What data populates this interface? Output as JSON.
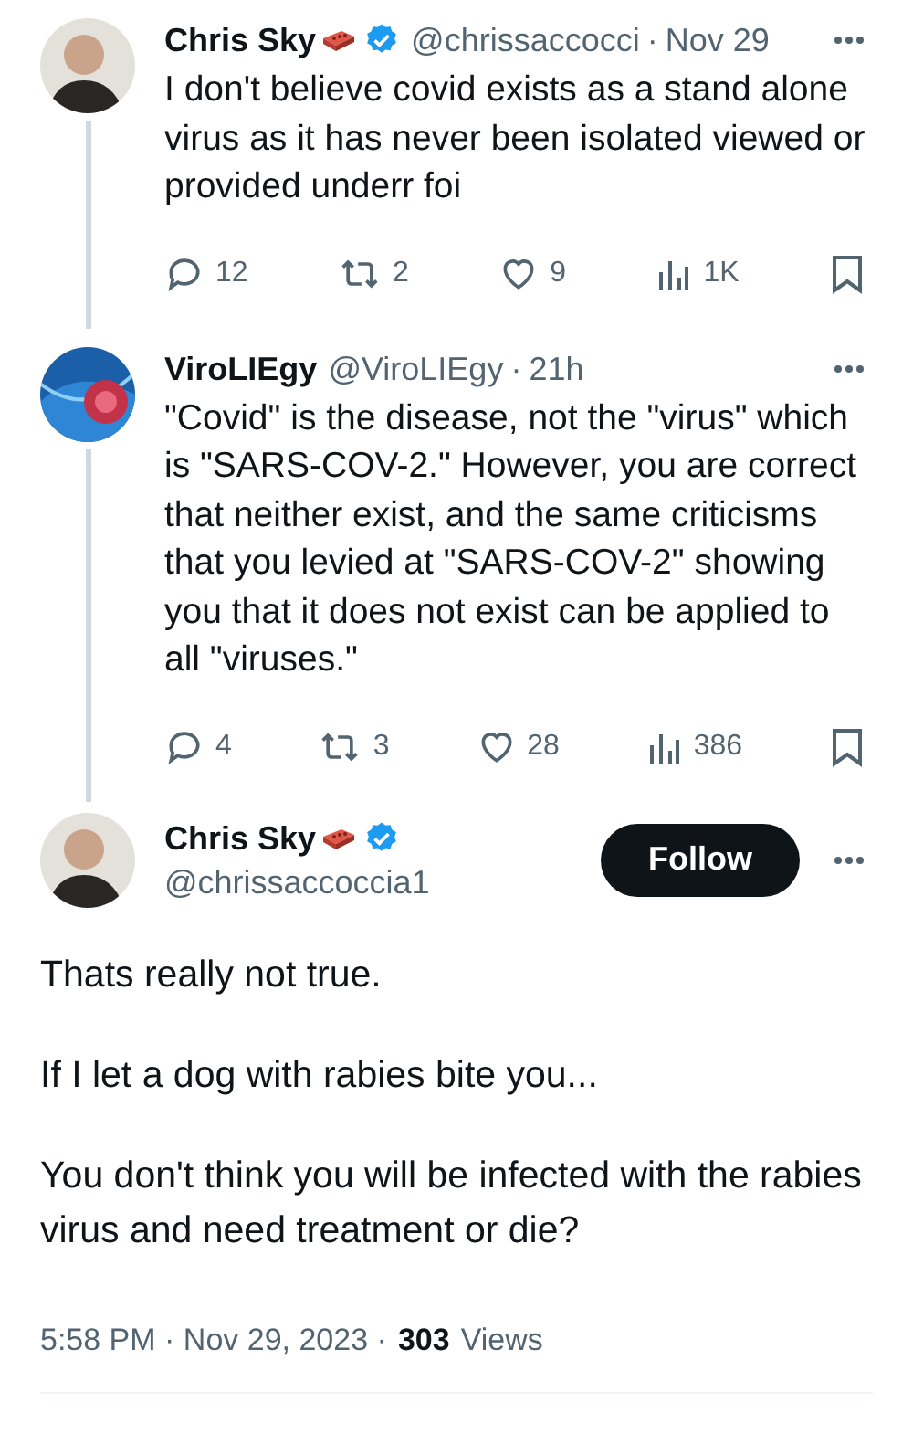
{
  "thread": [
    {
      "name": "Chris Sky",
      "brick_badge": true,
      "verified": true,
      "handle": "@chrissaccocci",
      "separator": "·",
      "time": "Nov 29",
      "body": "I don't believe covid exists as a stand alone virus as it has never been isolated viewed or provided underr foi",
      "stats": {
        "replies": "12",
        "reposts": "2",
        "likes": "9",
        "views": "1K"
      }
    },
    {
      "name": "ViroLIEgy",
      "brick_badge": false,
      "verified": false,
      "handle": "@ViroLIEgy",
      "separator": "·",
      "time": "21h",
      "body": "\"Covid\" is the disease, not the \"virus\" which is \"SARS-COV-2.\" However, you are correct that neither exist, and the same criticisms that you levied at \"SARS-COV-2\" showing you that it does not exist can be applied to all \"viruses.\"",
      "stats": {
        "replies": "4",
        "reposts": "3",
        "likes": "28",
        "views": "386"
      }
    }
  ],
  "main": {
    "name": "Chris Sky",
    "brick_badge": true,
    "verified": true,
    "handle": "@chrissaccoccia1",
    "follow_label": "Follow",
    "paragraphs": [
      "Thats really not true.",
      "If I let a dog with rabies bite you...",
      "You don't think you will be infected with the rabies virus and need treatment or die?"
    ],
    "timestamp": "5:58 PM · Nov 29, 2023 ·",
    "views_count": "303",
    "views_label": "Views"
  }
}
